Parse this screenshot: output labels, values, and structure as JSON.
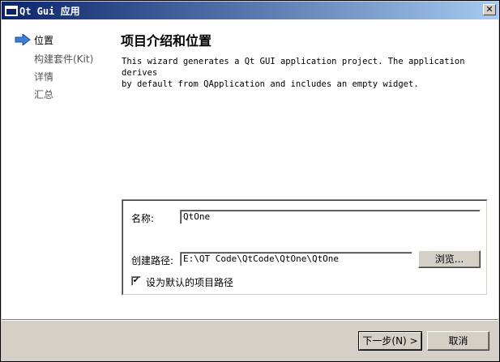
{
  "window": {
    "title": "Qt Gui 应用",
    "close_glyph": "✕"
  },
  "sidebar": {
    "steps": [
      {
        "label": "位置",
        "active": true
      },
      {
        "label": "构建套件(Kit)",
        "active": false
      },
      {
        "label": "详情",
        "active": false
      },
      {
        "label": "汇总",
        "active": false
      }
    ]
  },
  "main": {
    "title": "项目介绍和位置",
    "description_line1": "This wizard generates a Qt GUI application project. The application derives",
    "description_line2": "by default from QApplication and includes an empty widget."
  },
  "form": {
    "name_label": "名称:",
    "name_value": "QtOne",
    "path_label": "创建路径:",
    "path_value": "E:\\QT Code\\QtCode\\QtOne\\QtOne",
    "browse_label": "浏览...",
    "default_path_checkbox_label": "设为默认的项目路径",
    "default_path_checked": "✔"
  },
  "footer": {
    "next_label": "下一步(N) >",
    "cancel_label": "取消"
  },
  "colors": {
    "title_gradient_start": "#0a246a",
    "title_gradient_end": "#a6caf0",
    "active_arrow": "#3c7fd6"
  }
}
